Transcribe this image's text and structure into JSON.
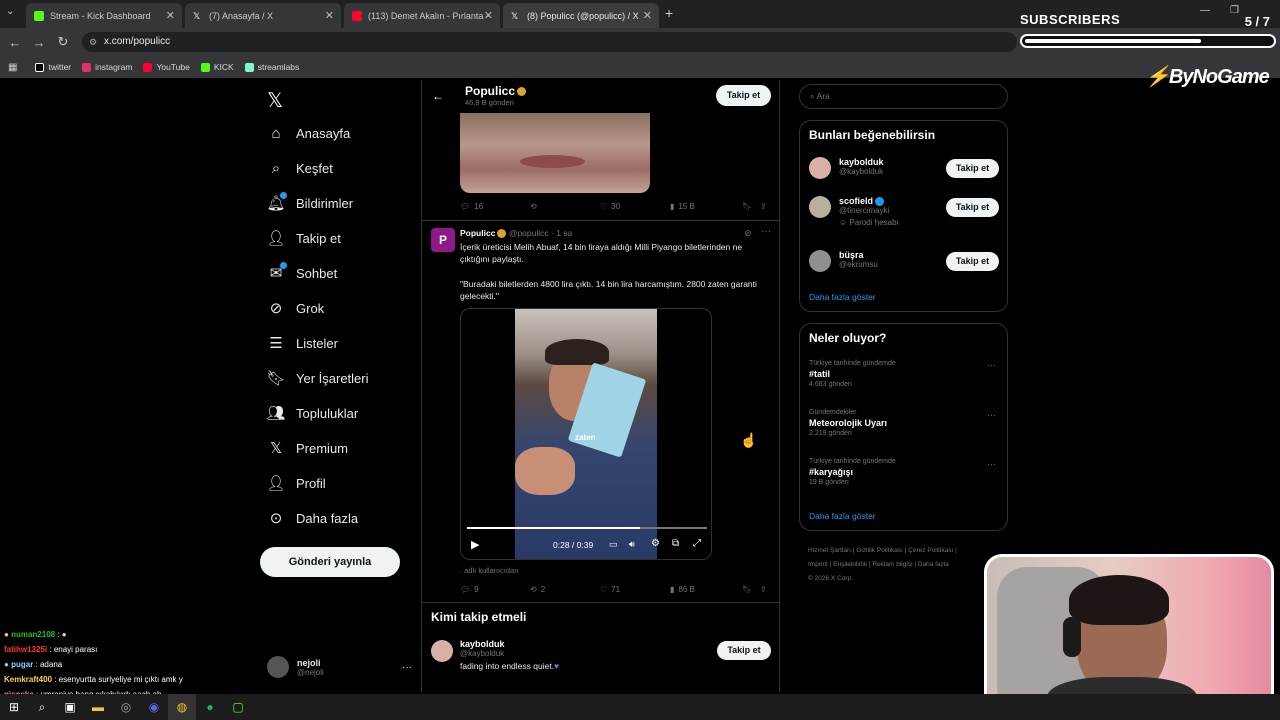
{
  "browser": {
    "tabs": [
      {
        "label": "Stream - Kick Dashboard",
        "color": "#53fc18"
      },
      {
        "label": "(7) Anasayfa / X",
        "color": "#ffffff"
      },
      {
        "label": "(113) Demet Akalın - Pırlanta -",
        "color": "#ff0033"
      },
      {
        "label": "(8) Populicc (@populicc) / X",
        "color": "#ffffff"
      }
    ],
    "url": "x.com/populicc",
    "bookmarks": [
      {
        "label": "twitter",
        "color": "#ffffff"
      },
      {
        "label": "instagram",
        "color": "#e1306c"
      },
      {
        "label": "YouTube",
        "color": "#ff0033"
      },
      {
        "label": "KICK",
        "color": "#53fc18"
      },
      {
        "label": "streamlabs",
        "color": "#80f5d2"
      }
    ]
  },
  "overlay": {
    "subs_label": "SUBSCRIBERS",
    "subs_count": "5 / 7",
    "subs_progress": 0.71,
    "brand": "ByNoGame"
  },
  "nav": {
    "items": [
      "Anasayfa",
      "Keşfet",
      "Bildirimler",
      "Takip et",
      "Sohbet",
      "Grok",
      "Listeler",
      "Yer İşaretleri",
      "Topluluklar",
      "Premium",
      "Profil",
      "Daha fazla"
    ],
    "post_label": "Gönderi yayınla",
    "user_name": "nejoli",
    "user_handle": "@nejoli"
  },
  "header": {
    "name": "Populicc",
    "posts": "46,8 B gönderi",
    "follow": "Takip et"
  },
  "post1": {
    "replies": "16",
    "likes": "30",
    "views": "15 B"
  },
  "post2": {
    "name": "Populicc",
    "handle": "@populicc",
    "time": "· 1 sa",
    "text1": "İçerik üreticisi Melih Abuaf, 14 bin liraya aldığı Milli Piyango biletlerinden ne çıktığını paylaştı.",
    "text2": "\"Buradaki biletlerden 4800 lira çıktı. 14 bin lira harcamıştım. 2800 zaten garanti gelecekti.\"",
    "video_caption": "zaten",
    "video_time": "0:28 / 0:39",
    "video_progress": 0.72,
    "credit": ". adlı kullanıcıdan",
    "replies": "9",
    "reposts": "2",
    "likes": "71",
    "views": "86 B"
  },
  "who_follow": {
    "title": "Kimi takip etmeli",
    "name": "kaybolduk",
    "handle": "@kaybolduk",
    "bio": "fading into endless quiet.",
    "follow": "Takip et"
  },
  "search": {
    "placeholder": "Ara"
  },
  "suggest": {
    "title": "Bunları beğenebilirsin",
    "users": [
      {
        "name": "kaybolduk",
        "handle": "@kaybolduk",
        "extra": "",
        "follow": "Takip et"
      },
      {
        "name": "scofield",
        "handle": "@tinercimayki",
        "extra": "Parodi hesabı",
        "follow": "Takip et"
      },
      {
        "name": "büşra",
        "handle": "@ekrumsu",
        "extra": "",
        "follow": "Takip et"
      }
    ],
    "more": "Daha fazla göster"
  },
  "trends": {
    "title": "Neler oluyor?",
    "items": [
      {
        "context": "Türkiye tarihinde gündemde",
        "topic": "#tatil",
        "count": "4.683 gönderi"
      },
      {
        "context": "Gündemdekiler",
        "topic": "Meteorolojik Uyarı",
        "count": "2.219 gönderi"
      },
      {
        "context": "Türkiye tarihinde gündemde",
        "topic": "#karyağışı",
        "count": "19 B gönderi"
      }
    ],
    "more": "Daha fazla göster"
  },
  "footer": {
    "line1": "Hizmet Şartları | Gizlilik Politikası | Çerez Politikası |",
    "line2": "Imprint | Erişilebilirlik | Reklam bilgisi | Daha fazla",
    "line3": "© 2026 X Corp."
  },
  "chat": [
    {
      "user": "numan2108",
      "msg": "",
      "color": "#1ec01e"
    },
    {
      "user": "fatihw1325i",
      "msg": "enayi parası",
      "color": "#ff3333"
    },
    {
      "user": "pugar",
      "msg": "adana",
      "color": "#8ad0ff"
    },
    {
      "user": "Kemkraft400",
      "msg": "esenyurtta suriyeliye mi çıktı amk y",
      "color": "#ffd23f"
    },
    {
      "user": "nisoske",
      "msg": "umraniye banq cıkabılırdı aaah ah",
      "color": "#ff7be5"
    }
  ],
  "colors": {
    "accent": "#1d9bf0",
    "bg": "#000000",
    "border": "#2f3336"
  }
}
